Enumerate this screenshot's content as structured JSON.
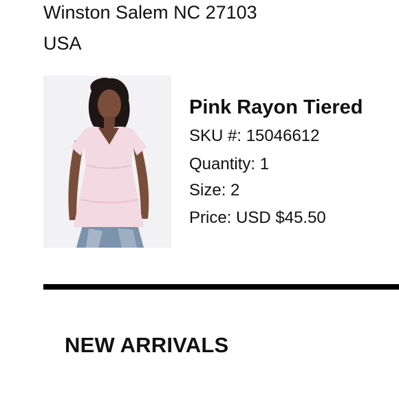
{
  "address": {
    "city_line": "Winston Salem NC 27103",
    "country": "USA"
  },
  "product": {
    "image_icon": "product-photo-model-pink-top",
    "title": "Pink Rayon Tiered",
    "sku_label": "SKU #:",
    "sku_value": "15046612",
    "quantity_label": "Quantity:",
    "quantity_value": "1",
    "size_label": "Size:",
    "size_value": "2",
    "price_label": "Price:",
    "price_value": "USD $45.50"
  },
  "section": {
    "heading": "NEW ARRIVALS"
  },
  "colors": {
    "text": "#111111",
    "divider": "#000000",
    "photo_background": "#f2f1f3",
    "top_pink": "#f3d9e2",
    "jeans_blue": "#7d93ad"
  }
}
